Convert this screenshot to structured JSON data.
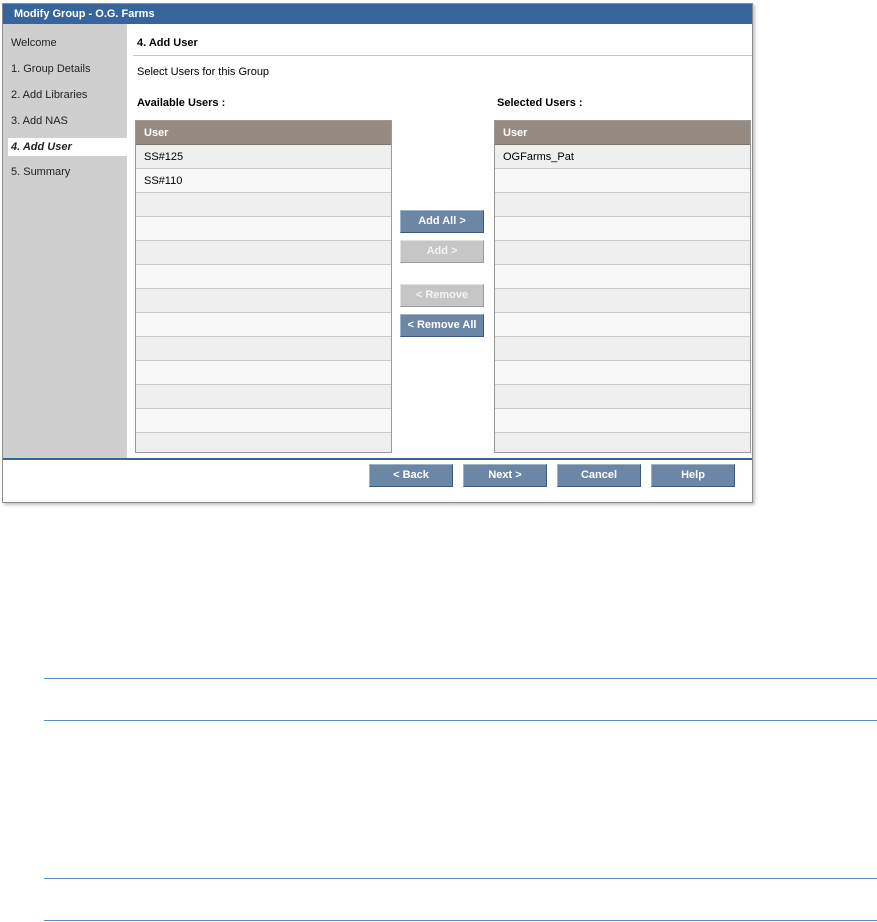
{
  "window": {
    "title": "Modify Group - O.G. Farms"
  },
  "sidebar": {
    "items": [
      {
        "label": "Welcome"
      },
      {
        "label": "1. Group Details"
      },
      {
        "label": "2. Add Libraries"
      },
      {
        "label": "3. Add NAS"
      },
      {
        "label": "4. Add User",
        "active": true
      },
      {
        "label": "5. Summary"
      }
    ]
  },
  "main": {
    "step_title": "4. Add User",
    "instruction": "Select Users for this Group",
    "available": {
      "label": "Available Users :",
      "column": "User",
      "rows": [
        "SS#125",
        "SS#110",
        "",
        "",
        "",
        "",
        "",
        "",
        "",
        "",
        "",
        "",
        ""
      ]
    },
    "selected": {
      "label": "Selected Users :",
      "column": "User",
      "rows": [
        "OGFarms_Pat",
        "",
        "",
        "",
        "",
        "",
        "",
        "",
        "",
        "",
        "",
        "",
        ""
      ]
    },
    "transfer": {
      "add_all": "Add All >",
      "add": "Add >",
      "remove": "< Remove",
      "remove_all": "< Remove All"
    }
  },
  "footer": {
    "back": "< Back",
    "next": "Next >",
    "cancel": "Cancel",
    "help": "Help"
  },
  "colors": {
    "titlebar": "#36659c",
    "sidebar": "#cfcfcf",
    "list_header": "#958b82",
    "button_enabled": "#6c86a5",
    "button_disabled": "#c6c6c6"
  }
}
